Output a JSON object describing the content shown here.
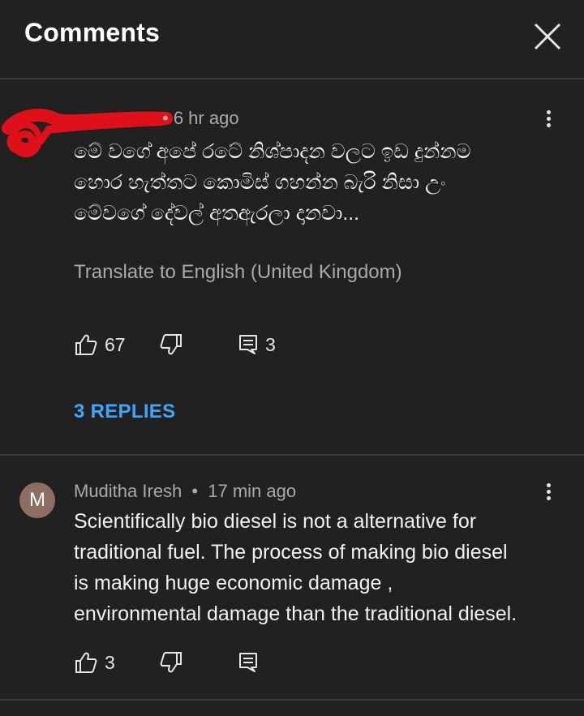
{
  "header": {
    "title": "Comments"
  },
  "comments": [
    {
      "author": "",
      "time": "6 hr ago",
      "separator": "•",
      "lines": [
        "මේ වගේ අපේ රටේ නිශ්පාදන වලට ඉඩ දුන්නම",
        "හොර හැත්තට කොමිස් ගහන්න බැරි නිසා උං",
        "මේවගේ දේවල් අතඇරලා දානවා..."
      ],
      "translate": "Translate to English (United Kingdom)",
      "likes": "67",
      "reply_count": "3",
      "replies_label": "3 REPLIES"
    },
    {
      "avatar_letter": "M",
      "author": "Muditha Iresh",
      "separator": "•",
      "time": "17 min ago",
      "lines": [
        "Scientifically bio diesel is not a alternative for",
        "traditional fuel. The process of making bio diesel",
        "is making huge economic damage ,",
        "environmental damage than the traditional diesel."
      ],
      "likes": "3"
    }
  ],
  "icons": {
    "close": "close-icon",
    "menu": "more-vert-icon",
    "like": "thumb-up-icon",
    "dislike": "thumb-down-icon",
    "reply": "comment-icon"
  },
  "colors": {
    "background": "#212121",
    "accent": "#3ea6ff",
    "redaction": "#e0101a",
    "avatar": "#8d6e63"
  }
}
